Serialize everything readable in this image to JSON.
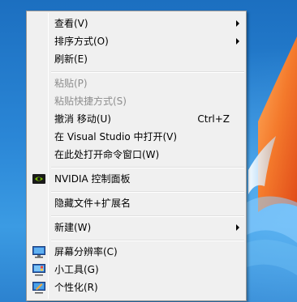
{
  "menu": {
    "items": [
      {
        "label": "查看(V)",
        "submenu": true
      },
      {
        "label": "排序方式(O)",
        "submenu": true
      },
      {
        "label": "刷新(E)"
      },
      {
        "label": "粘贴(P)",
        "disabled": true
      },
      {
        "label": "粘贴快捷方式(S)",
        "disabled": true
      },
      {
        "label": "撤消 移动(U)",
        "shortcut": "Ctrl+Z"
      },
      {
        "label": "在 Visual Studio 中打开(V)"
      },
      {
        "label": "在此处打开命令窗口(W)"
      },
      {
        "label": "NVIDIA 控制面板",
        "icon": "nvidia-icon"
      },
      {
        "label": "隐藏文件+扩展名"
      },
      {
        "label": "新建(W)",
        "submenu": true
      },
      {
        "label": "屏幕分辨率(C)",
        "icon": "display-icon"
      },
      {
        "label": "小工具(G)",
        "icon": "gadgets-icon"
      },
      {
        "label": "个性化(R)",
        "icon": "personalize-icon"
      }
    ]
  },
  "colors": {
    "menu_background": "#f0f0f0",
    "disabled_text": "#8d8d8d",
    "wallpaper_blue": "#1f78c7",
    "wallpaper_orange": "#f0702a"
  }
}
